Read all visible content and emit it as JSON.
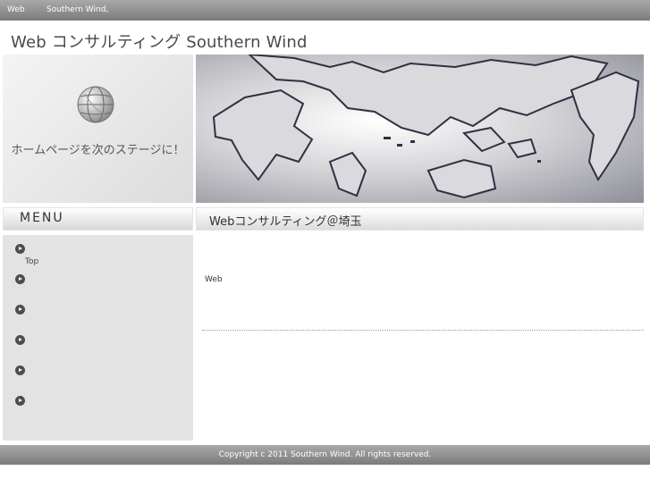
{
  "topbar": {
    "item1": "Web",
    "item2": "Southern Wind,"
  },
  "site_title": "Web コンサルティング Southern Wind",
  "hero": {
    "tagline": "ホームページを次のステージに！"
  },
  "sidebar": {
    "heading": "MENU",
    "items": [
      {
        "label": "Top"
      },
      {
        "label": ""
      },
      {
        "label": ""
      },
      {
        "label": ""
      },
      {
        "label": ""
      },
      {
        "label": ""
      }
    ]
  },
  "content": {
    "heading": "Webコンサルティング＠埼玉",
    "text": "Web"
  },
  "footer": {
    "copyright": "Copyright c 2011 Southern Wind. All rights reserved."
  },
  "colors": {
    "bar_gray": "#8f8f8f",
    "sidebar_bg": "#e3e3e3",
    "title_text": "#4a4a4a"
  },
  "icons": [
    "globe-icon",
    "bullet-arrow-icon"
  ]
}
